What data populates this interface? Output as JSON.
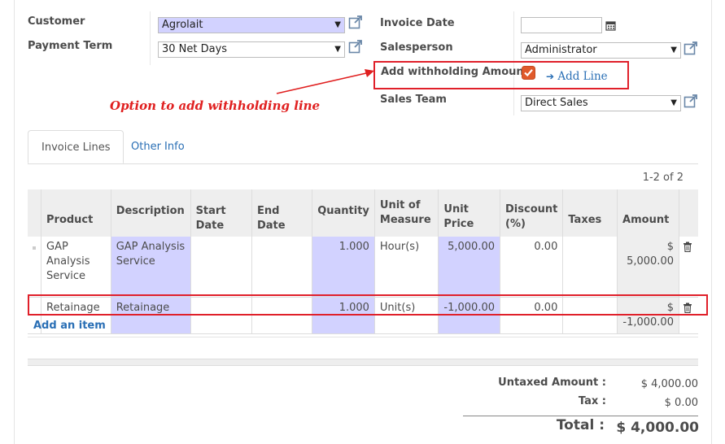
{
  "header": {
    "customer_label": "Customer",
    "customer_value": "Agrolait",
    "payment_term_label": "Payment Term",
    "payment_term_value": "30 Net Days",
    "invoice_date_label": "Invoice Date",
    "invoice_date_value": "",
    "salesperson_label": "Salesperson",
    "salesperson_value": "Administrator",
    "withholding_label": "Add withholding Amount",
    "withholding_checked": true,
    "add_line_label": "Add Line",
    "sales_team_label": "Sales Team",
    "sales_team_value": "Direct Sales"
  },
  "annotation": {
    "text": "Option to add withholding line",
    "color": "#e02020"
  },
  "tabs": [
    {
      "label": "Invoice Lines",
      "active": true
    },
    {
      "label": "Other Info",
      "active": false
    }
  ],
  "pager": "1-2 of 2",
  "table": {
    "columns": [
      "Product",
      "Description",
      "Start Date",
      "End Date",
      "Quantity",
      "Unit of Measure",
      "Unit Price",
      "Discount (%)",
      "Taxes",
      "Amount"
    ],
    "rows": [
      {
        "product": "GAP Analysis Service",
        "description": "GAP Analysis Service",
        "start_date": "",
        "end_date": "",
        "quantity": "1.000",
        "uom": "Hour(s)",
        "unit_price": "5,000.00",
        "discount": "0.00",
        "taxes": "",
        "amount": "$ 5,000.00"
      },
      {
        "product": "Retainage",
        "description": "Retainage",
        "start_date": "",
        "end_date": "",
        "quantity": "1.000",
        "uom": "Unit(s)",
        "unit_price": "-1,000.00",
        "discount": "0.00",
        "taxes": "",
        "amount": "$ -1,000.00"
      }
    ],
    "add_item_label": "Add an item"
  },
  "totals": {
    "untaxed_label": "Untaxed Amount :",
    "untaxed_value": "$ 4,000.00",
    "tax_label": "Tax :",
    "tax_value": "$ 0.00",
    "total_label": "Total :",
    "total_value": "$ 4,000.00"
  },
  "colors": {
    "required_field": "#d2d2ff",
    "link": "#2a6fb5",
    "highlight_box": "#e0202a",
    "checkbox": "#e05a2b"
  }
}
